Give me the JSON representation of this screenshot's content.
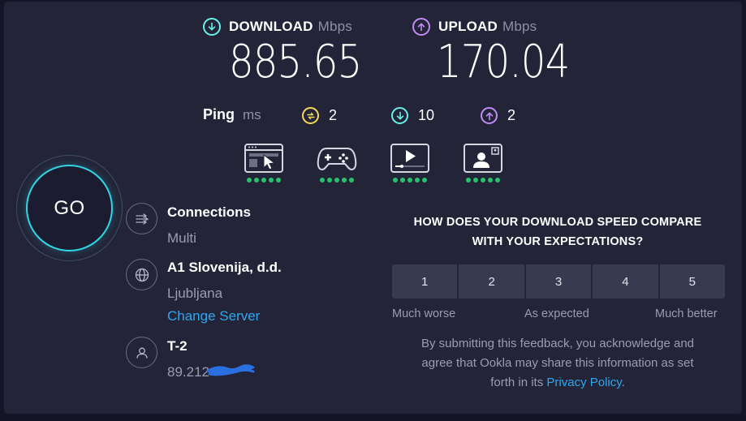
{
  "download": {
    "label": "DOWNLOAD",
    "unit": "Mbps",
    "value": "885.65"
  },
  "upload": {
    "label": "UPLOAD",
    "unit": "Mbps",
    "value": "170.04"
  },
  "ping": {
    "label": "Ping",
    "unit": "ms",
    "idle": "2",
    "download": "10",
    "upload": "2"
  },
  "activities": [
    {
      "icon": "web-browsing-icon",
      "rating": 5
    },
    {
      "icon": "gaming-icon",
      "rating": 5
    },
    {
      "icon": "video-streaming-icon",
      "rating": 5
    },
    {
      "icon": "video-chat-icon",
      "rating": 5
    }
  ],
  "go": {
    "label": "GO"
  },
  "connections": {
    "title": "Connections",
    "value": "Multi"
  },
  "server": {
    "title": "A1 Slovenija, d.d.",
    "location": "Ljubljana",
    "change_label": "Change Server"
  },
  "provider": {
    "title": "T-2",
    "ip": "89.212"
  },
  "feedback": {
    "question_line1": "HOW DOES YOUR DOWNLOAD SPEED COMPARE",
    "question_line2": "WITH YOUR EXPECTATIONS?",
    "options": [
      "1",
      "2",
      "3",
      "4",
      "5"
    ],
    "scale_low": "Much worse",
    "scale_mid": "As expected",
    "scale_high": "Much better",
    "disclaimer_line1": "By submitting this feedback, you acknowledge and",
    "disclaimer_line2": "agree that Ookla may share this information as set",
    "disclaimer_line3_pre": "forth in its ",
    "privacy_link": "Privacy Policy",
    "disclaimer_line3_post": "."
  },
  "colors": {
    "background": "#141526",
    "panel": "#232438",
    "download_accent": "#6af0e8",
    "upload_accent": "#c18cf5",
    "idle_ping_accent": "#f5d75a",
    "link": "#2ea7f0",
    "rating_good": "#27c26c"
  }
}
